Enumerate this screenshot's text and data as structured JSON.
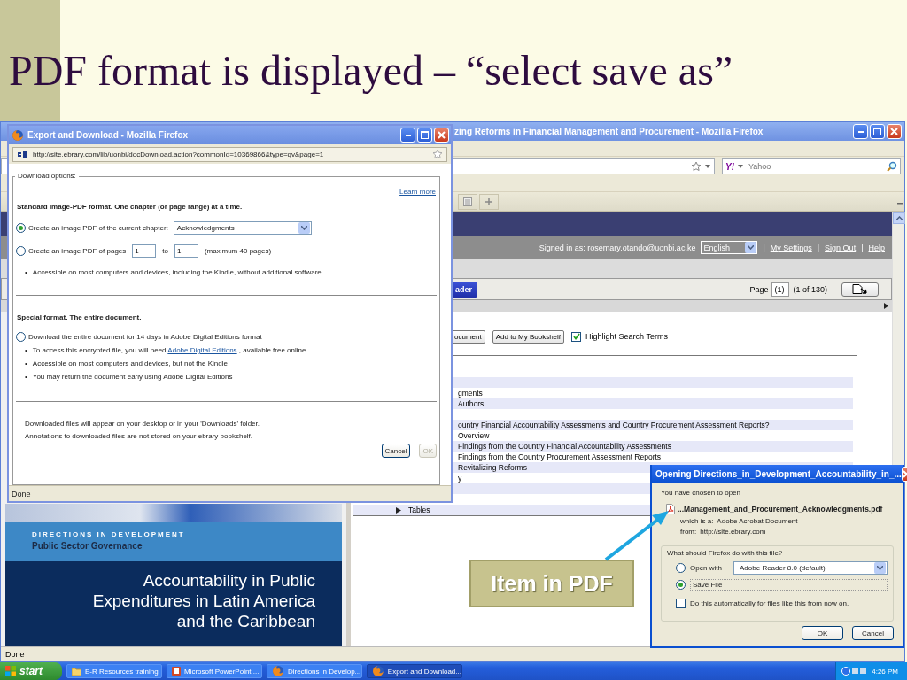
{
  "slide": {
    "title": "PDF format is displayed – “select save as”"
  },
  "browser": {
    "title": "zing Reforms in Financial Management and Procurement - Mozilla Firefox",
    "search_logo": "Y!",
    "search_placeholder": "Yahoo",
    "account": {
      "signed_in": "Signed in as: rosemary.otando@uonbi.ac.ke",
      "language": "English",
      "separator": "|",
      "links": [
        "My Settings",
        "Sign Out",
        "Help"
      ]
    },
    "toolbar": {
      "reader_button": "ader",
      "page_label": "Page",
      "page_value": "(1)",
      "page_count": "(1 of 130)"
    },
    "actions": {
      "document_button": "ocument",
      "bookshelf_button": "Add to My Bookshelf",
      "highlight": {
        "label": "Highlight Search Terms",
        "checked": true
      }
    },
    "toc": [
      {
        "kind": "entry",
        "shaded": false
      },
      {
        "kind": "entry",
        "shaded": true
      },
      {
        "kind": "entry",
        "text": "gments",
        "shaded": false
      },
      {
        "kind": "entry",
        "text": "Authors",
        "shaded": true
      },
      {
        "kind": "entry",
        "shaded": false
      },
      {
        "kind": "entry",
        "text": "ountry Financial Accountability Assessments and Country Procurement Assessment Reports?",
        "shaded": true
      },
      {
        "kind": "entry",
        "text": "Overview",
        "shaded": false
      },
      {
        "kind": "entry",
        "text": "Findings from the Country Financial Accountability Assessments",
        "shaded": true
      },
      {
        "kind": "entry",
        "text": "Findings from the Country Procurement Assessment Reports",
        "shaded": false
      },
      {
        "kind": "entry",
        "text": "Revitalizing Reforms",
        "shaded": true
      },
      {
        "kind": "entry",
        "text": "y",
        "shaded": false
      },
      {
        "kind": "entry",
        "shaded": true
      },
      {
        "kind": "entry",
        "shaded": false
      },
      {
        "kind": "group",
        "text": "Tables",
        "shaded": true
      }
    ],
    "cover": {
      "series": "DIRECTIONS IN DEVELOPMENT",
      "subseries": "Public Sector Governance",
      "title_lines": [
        "Accountability in Public",
        "Expenditures in Latin America",
        "and the Caribbean"
      ]
    },
    "status": "Done"
  },
  "export_dialog": {
    "title": "Export and Download - Mozilla Firefox",
    "bullet_mark": "•",
    "url": "http://site.ebrary.com/lib/uonbi/docDownload.action?commonId=10369866&type=qv&page=1",
    "legend": "Download options:",
    "learn_more": "Learn more",
    "sections": [
      {
        "heading": "Standard image-PDF format. One chapter (or page range) at a time.",
        "options": [
          {
            "kind": "chapter",
            "label": "Create an image PDF of the current chapter:",
            "selected": true,
            "chapter": "Acknowledgments"
          },
          {
            "kind": "pages",
            "label": "Create an image PDF of pages",
            "selected": false,
            "from": "1",
            "to_label": "to",
            "to": "1",
            "note": "(maximum 40 pages)"
          }
        ],
        "bullets": [
          {
            "text": "Accessible on most computers and devices, including the Kindle, without additional software"
          }
        ]
      },
      {
        "heading": "Special format. The entire document.",
        "options": [
          {
            "kind": "plain",
            "label": "Download the entire document for 14 days in Adobe Digital Editions format",
            "selected": false
          }
        ],
        "bullets": [
          {
            "text": "To access this encrypted file, you will need",
            "link": "Adobe Digital Editions",
            "after": ", available free online"
          },
          {
            "text": "Accessible on most computers and devices, but not the Kindle"
          },
          {
            "text": "You may return the document early using Adobe Digital Editions"
          }
        ]
      }
    ],
    "notes": [
      "Downloaded files will appear on your desktop or in your 'Downloads' folder.",
      "Annotations to downloaded files are not stored on your ebrary bookshelf."
    ],
    "buttons": [
      {
        "label": "Cancel",
        "disabled": false
      },
      {
        "label": "OK",
        "disabled": true
      }
    ],
    "status": "Done"
  },
  "open_dialog": {
    "title": "Opening Directions_in_Development_Accountability_in_...",
    "intro": "You have chosen to open",
    "filename": "...Management_and_Procurement_Acknowledgments.pdf",
    "type_label": "which is a:",
    "type": "Adobe Acrobat Document",
    "from_label": "from:",
    "from": "http://site.ebrary.com",
    "question": "What should Firefox do with this file?",
    "choices": [
      {
        "kind": "open",
        "label": "Open with",
        "selected": false,
        "app": "Adobe Reader 8.0 (default)"
      },
      {
        "kind": "save",
        "label": "Save File",
        "selected": true
      }
    ],
    "auto": {
      "label": "Do this automatically for files like this from now on.",
      "checked": false
    },
    "buttons": [
      "OK",
      "Cancel"
    ]
  },
  "callout": {
    "text": "Item in PDF"
  },
  "taskbar": {
    "start": "start",
    "tasks": [
      {
        "kind": "folder",
        "label": "E-R Resources training",
        "selected": false
      },
      {
        "kind": "powerpoint",
        "label": "Microsoft PowerPoint ...",
        "selected": false
      },
      {
        "kind": "firefox",
        "label": "Directions in Develop...",
        "selected": false
      },
      {
        "kind": "firefox",
        "label": "Export and Download...",
        "selected": true
      }
    ],
    "clock": "4:26 PM"
  }
}
